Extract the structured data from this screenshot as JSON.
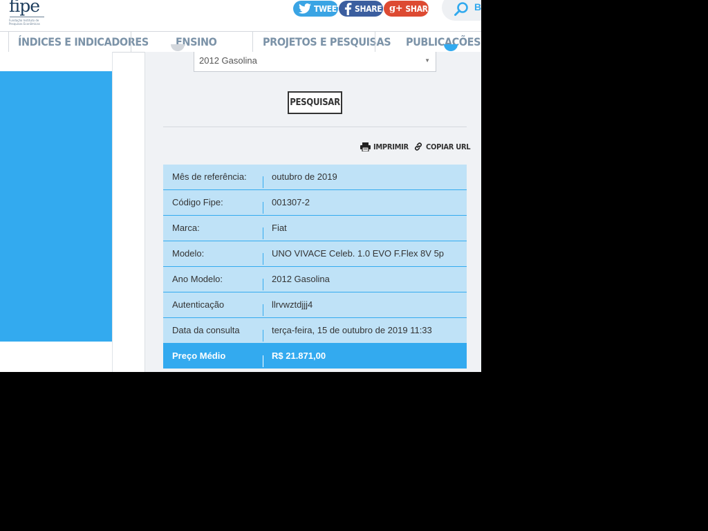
{
  "header": {
    "logo": {
      "word": "fipe",
      "sub_line1": "Fundação Instituto de",
      "sub_line2": "Pesquisas Econômicas"
    },
    "share_buttons": [
      {
        "label": "TWEET",
        "icon": "twitter-icon",
        "color": "#3aa4e4"
      },
      {
        "label": "SHARE",
        "icon": "facebook-icon",
        "color": "#3b5e9f"
      },
      {
        "label": "SHARE",
        "icon": "google-plus-icon",
        "glyph": "g+",
        "color": "#dd4a32"
      }
    ],
    "search": {
      "icon": "search-icon",
      "label": "B"
    }
  },
  "nav": {
    "items": [
      {
        "label": "ÍNDICES E INDICADORES"
      },
      {
        "label": "ENSINO"
      },
      {
        "label": "PROJETOS E PESQUISAS"
      },
      {
        "label": "PUBLICAÇÕES"
      }
    ]
  },
  "form": {
    "ano_select_value": "2012 Gasolina",
    "search_button": "PESQUISAR"
  },
  "tools": {
    "print_label": "IMPRIMIR",
    "print_icon": "printer-icon",
    "copy_label": "COPIAR URL",
    "copy_icon": "link-icon"
  },
  "result": {
    "rows": [
      {
        "key": "Mês de referência:",
        "value": "outubro de 2019"
      },
      {
        "key": "Código Fipe:",
        "value": "001307-2"
      },
      {
        "key": "Marca:",
        "value": "Fiat"
      },
      {
        "key": "Modelo:",
        "value": "UNO VIVACE Celeb. 1.0 EVO F.Flex 8V 5p"
      },
      {
        "key": "Ano Modelo:",
        "value": "2012 Gasolina"
      },
      {
        "key": "Autenticação",
        "value": "llrvwztdjjj4"
      },
      {
        "key": "Data da consulta",
        "value": "terça-feira, 15 de outubro de 2019 11:33"
      },
      {
        "key": "Preço Médio",
        "value": "R$ 21.871,00"
      }
    ]
  },
  "colors": {
    "accent": "#33aaef",
    "row_bg": "#bfe2f7",
    "nav_text": "#7c93a8",
    "panel_bg": "#f0f2f5"
  }
}
